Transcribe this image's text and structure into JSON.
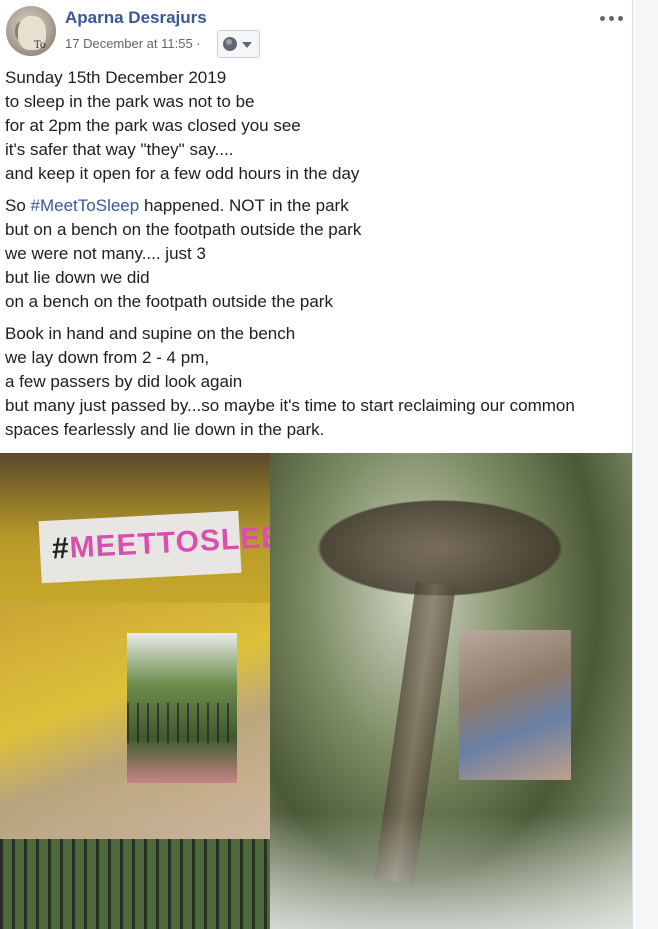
{
  "post": {
    "author": "Aparna Desrajurs",
    "timestamp": "17 December at 11:55",
    "separator": "·",
    "avatar_caption": "To",
    "audience_icon": "globe-icon",
    "more_icon": "more-options-icon",
    "paragraphs": [
      {
        "lines": [
          "Sunday 15th December 2019",
          "to sleep in the park was not to be",
          "for at 2pm the park was closed you see",
          "it's safer that way \"they\" say....",
          "and keep it open for a few odd hours in the day"
        ]
      },
      {
        "lead": "So ",
        "hashtag": "#MeetToSleep",
        "lead_rest": " happened. NOT in the park",
        "lines": [
          "but on a bench on the footpath outside the park",
          "we were not many.... just 3",
          "but lie down we did",
          "on a bench on the footpath outside the park"
        ]
      },
      {
        "lines": [
          "Book in hand and supine on the bench",
          "we lay down from 2 - 4 pm,",
          "a few passers by did look again",
          "but many just passed by...so maybe it's time to start reclaiming our common spaces fearlessly and lie down in the park."
        ]
      }
    ],
    "photo": {
      "poster_hash": "#",
      "poster_text": "MEETTOSLEEP"
    }
  },
  "colors": {
    "link": "#385898",
    "text": "#1c1e21",
    "meta": "#606770"
  }
}
